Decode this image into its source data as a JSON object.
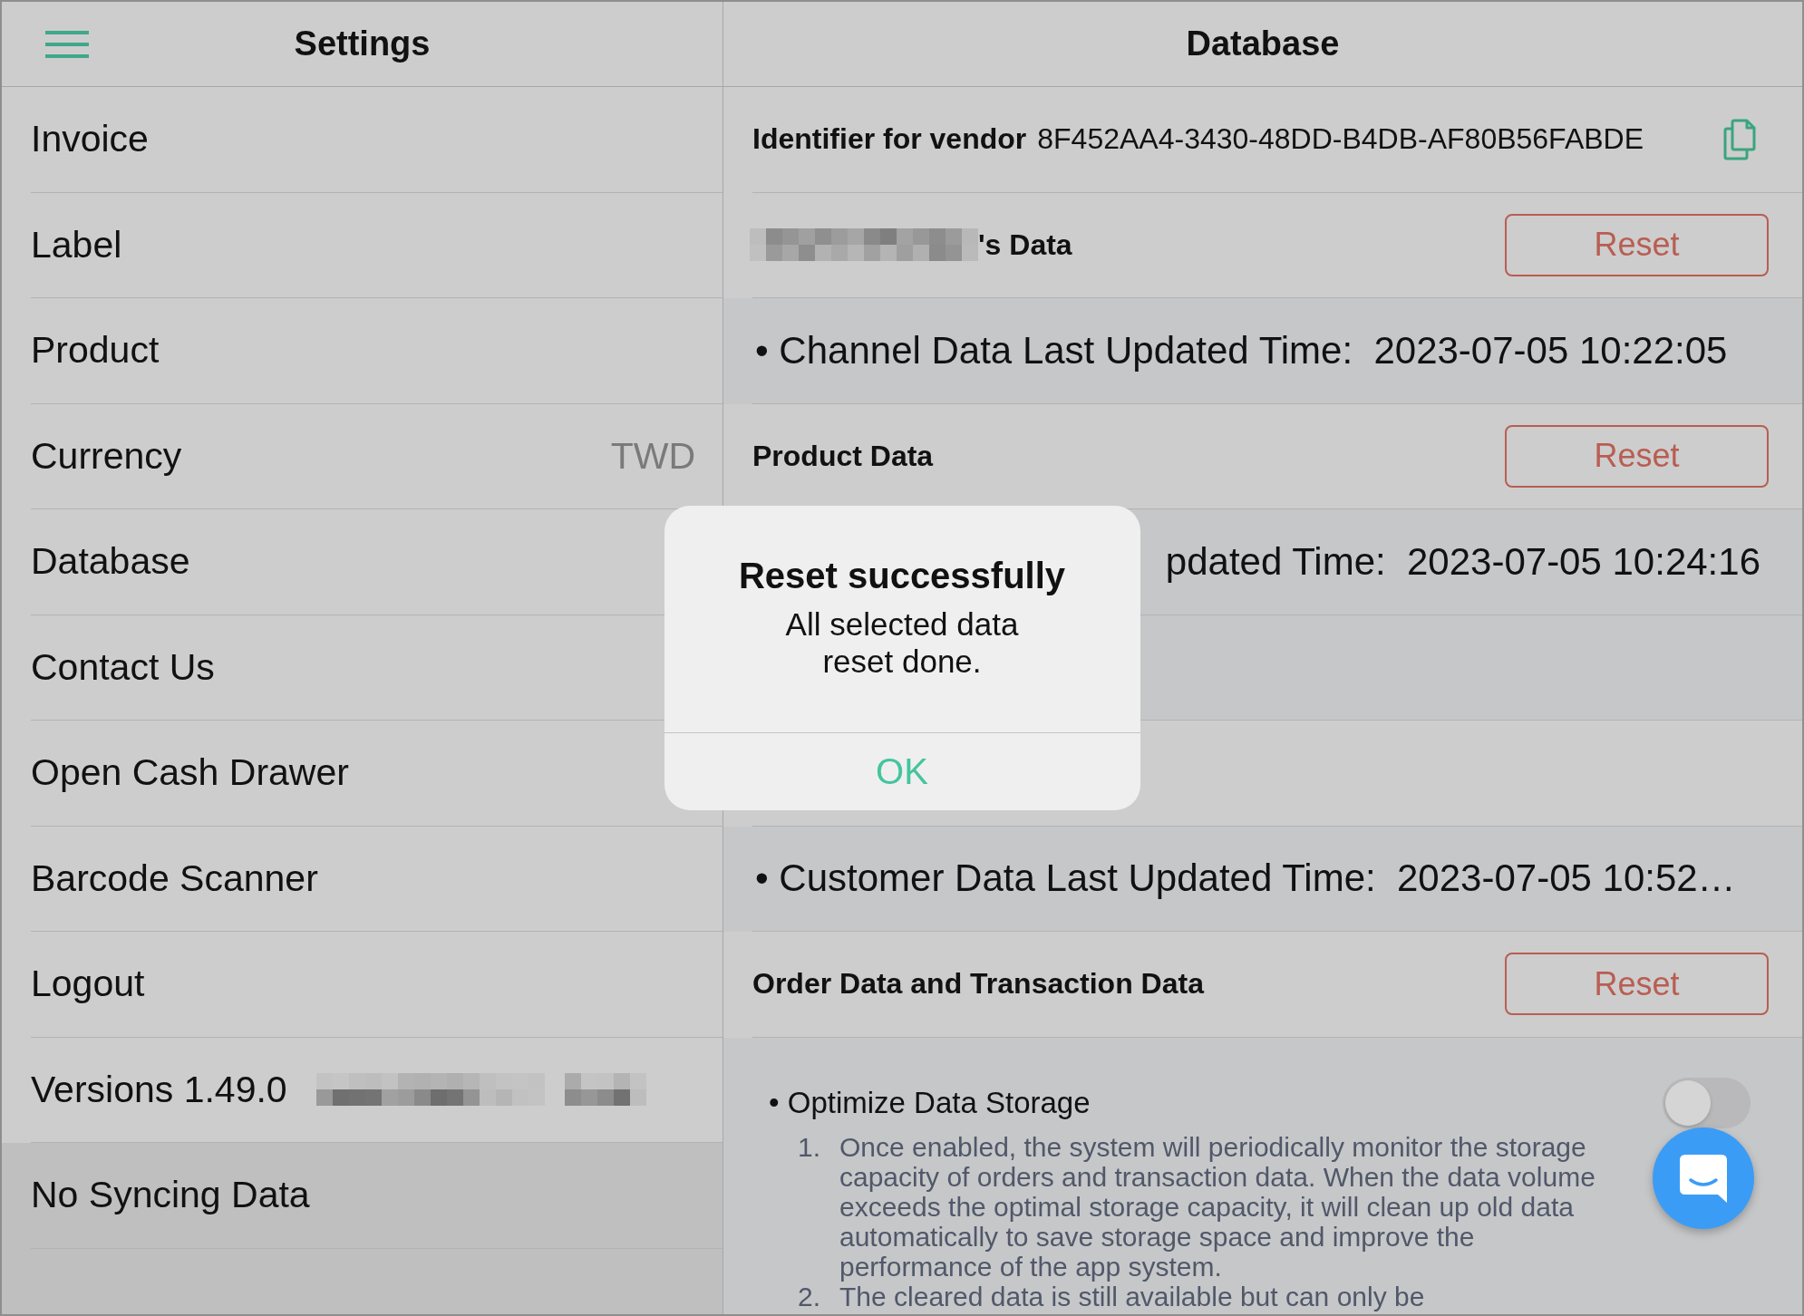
{
  "sidebar": {
    "title": "Settings",
    "items": [
      {
        "label": "Invoice"
      },
      {
        "label": "Label"
      },
      {
        "label": "Product"
      },
      {
        "label": "Currency",
        "value": "TWD"
      },
      {
        "label": "Database"
      },
      {
        "label": "Contact Us"
      },
      {
        "label": "Open Cash Drawer"
      },
      {
        "label": "Barcode Scanner"
      },
      {
        "label": "Logout"
      },
      {
        "label": "Versions 1.49.0",
        "redacted": true
      }
    ],
    "sync_status": "No Syncing Data"
  },
  "detail": {
    "title": "Database",
    "identifier": {
      "label": "Identifier for vendor",
      "value": "8F452AA4-3430-48DD-B4DB-AF80B56FABDE"
    },
    "rows": [
      {
        "kind": "section",
        "label": "'s Data",
        "redacted": true,
        "button": "Reset"
      },
      {
        "kind": "time",
        "text": "• Channel Data Last Updated Time:  2023-07-05 10:22:05"
      },
      {
        "kind": "section",
        "label": "Product Data",
        "button": "Reset"
      },
      {
        "kind": "time",
        "text": "pdated Time:  2023-07-05 10:24:16",
        "partly_hidden": true
      },
      {
        "kind": "time"
      },
      {
        "kind": "blank"
      },
      {
        "kind": "time",
        "text": "• Customer Data Last Updated Time:  2023-07-05 10:52…"
      },
      {
        "kind": "section",
        "label": "Order Data and Transaction Data",
        "button": "Reset"
      }
    ],
    "optimize": {
      "label": "• Optimize Data Storage",
      "on": false,
      "notes": [
        {
          "number": "1.",
          "text": "Once enabled, the system will periodically monitor the storage capacity of orders and transaction data. When the data volume exceeds the optimal storage capacity, it will clean up old data automatically to save storage space and improve the performance of the app system."
        },
        {
          "number": "2.",
          "text": "The cleared data is still available but can only be"
        }
      ]
    }
  },
  "dialog": {
    "title": "Reset successfully",
    "message": "All selected data reset done.",
    "button": "OK"
  }
}
